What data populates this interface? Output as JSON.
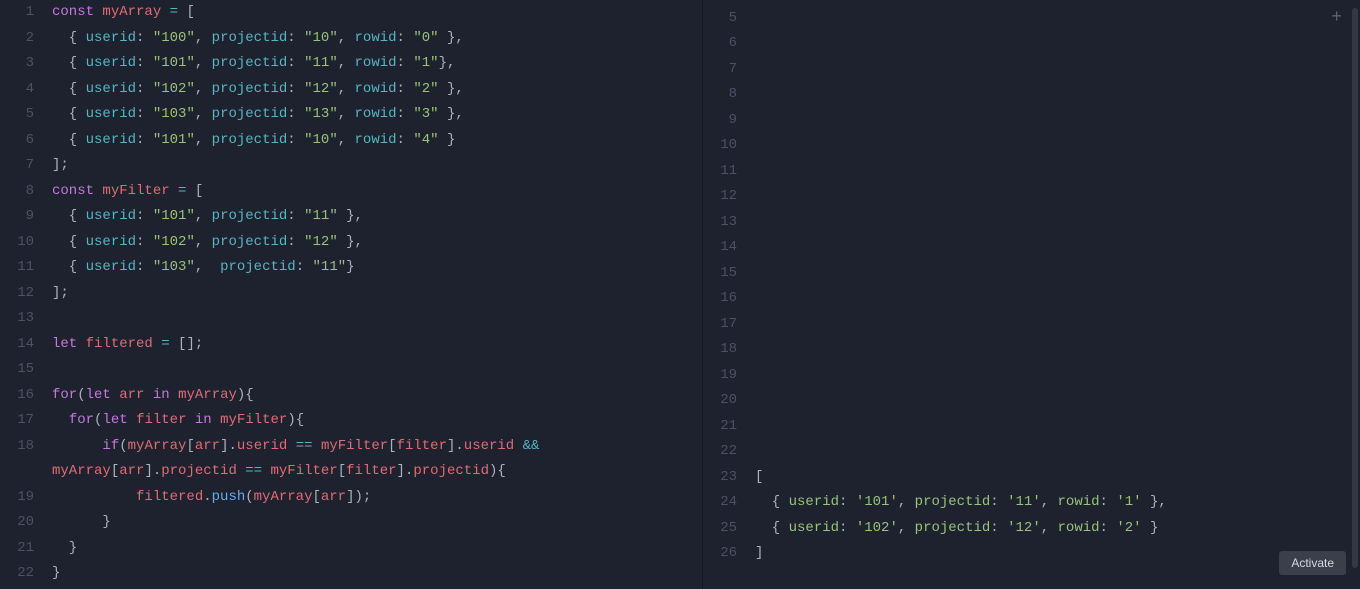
{
  "leftPane": {
    "startLine": 1,
    "lines": [
      [
        [
          "kw",
          "const"
        ],
        [
          "punc",
          " "
        ],
        [
          "var",
          "myArray"
        ],
        [
          "punc",
          " "
        ],
        [
          "op",
          "="
        ],
        [
          "punc",
          " ["
        ]
      ],
      [
        [
          "punc",
          "  { "
        ],
        [
          "prop",
          "userid"
        ],
        [
          "punc",
          ": "
        ],
        [
          "str",
          "\"100\""
        ],
        [
          "punc",
          ", "
        ],
        [
          "prop",
          "projectid"
        ],
        [
          "punc",
          ": "
        ],
        [
          "str",
          "\"10\""
        ],
        [
          "punc",
          ", "
        ],
        [
          "prop",
          "rowid"
        ],
        [
          "punc",
          ": "
        ],
        [
          "str",
          "\"0\""
        ],
        [
          "punc",
          " },"
        ]
      ],
      [
        [
          "punc",
          "  { "
        ],
        [
          "prop",
          "userid"
        ],
        [
          "punc",
          ": "
        ],
        [
          "str",
          "\"101\""
        ],
        [
          "punc",
          ", "
        ],
        [
          "prop",
          "projectid"
        ],
        [
          "punc",
          ": "
        ],
        [
          "str",
          "\"11\""
        ],
        [
          "punc",
          ", "
        ],
        [
          "prop",
          "rowid"
        ],
        [
          "punc",
          ": "
        ],
        [
          "str",
          "\"1\""
        ],
        [
          "punc",
          "},"
        ]
      ],
      [
        [
          "punc",
          "  { "
        ],
        [
          "prop",
          "userid"
        ],
        [
          "punc",
          ": "
        ],
        [
          "str",
          "\"102\""
        ],
        [
          "punc",
          ", "
        ],
        [
          "prop",
          "projectid"
        ],
        [
          "punc",
          ": "
        ],
        [
          "str",
          "\"12\""
        ],
        [
          "punc",
          ", "
        ],
        [
          "prop",
          "rowid"
        ],
        [
          "punc",
          ": "
        ],
        [
          "str",
          "\"2\""
        ],
        [
          "punc",
          " },"
        ]
      ],
      [
        [
          "punc",
          "  { "
        ],
        [
          "prop",
          "userid"
        ],
        [
          "punc",
          ": "
        ],
        [
          "str",
          "\"103\""
        ],
        [
          "punc",
          ", "
        ],
        [
          "prop",
          "projectid"
        ],
        [
          "punc",
          ": "
        ],
        [
          "str",
          "\"13\""
        ],
        [
          "punc",
          ", "
        ],
        [
          "prop",
          "rowid"
        ],
        [
          "punc",
          ": "
        ],
        [
          "str",
          "\"3\""
        ],
        [
          "punc",
          " },"
        ]
      ],
      [
        [
          "punc",
          "  { "
        ],
        [
          "prop",
          "userid"
        ],
        [
          "punc",
          ": "
        ],
        [
          "str",
          "\"101\""
        ],
        [
          "punc",
          ", "
        ],
        [
          "prop",
          "projectid"
        ],
        [
          "punc",
          ": "
        ],
        [
          "str",
          "\"10\""
        ],
        [
          "punc",
          ", "
        ],
        [
          "prop",
          "rowid"
        ],
        [
          "punc",
          ": "
        ],
        [
          "str",
          "\"4\""
        ],
        [
          "punc",
          " }"
        ]
      ],
      [
        [
          "punc",
          "];"
        ]
      ],
      [
        [
          "kw",
          "const"
        ],
        [
          "punc",
          " "
        ],
        [
          "var",
          "myFilter"
        ],
        [
          "punc",
          " "
        ],
        [
          "op",
          "="
        ],
        [
          "punc",
          " ["
        ]
      ],
      [
        [
          "punc",
          "  { "
        ],
        [
          "prop",
          "userid"
        ],
        [
          "punc",
          ": "
        ],
        [
          "str",
          "\"101\""
        ],
        [
          "punc",
          ", "
        ],
        [
          "prop",
          "projectid"
        ],
        [
          "punc",
          ": "
        ],
        [
          "str",
          "\"11\""
        ],
        [
          "punc",
          " },"
        ]
      ],
      [
        [
          "punc",
          "  { "
        ],
        [
          "prop",
          "userid"
        ],
        [
          "punc",
          ": "
        ],
        [
          "str",
          "\"102\""
        ],
        [
          "punc",
          ", "
        ],
        [
          "prop",
          "projectid"
        ],
        [
          "punc",
          ": "
        ],
        [
          "str",
          "\"12\""
        ],
        [
          "punc",
          " },"
        ]
      ],
      [
        [
          "punc",
          "  { "
        ],
        [
          "prop",
          "userid"
        ],
        [
          "punc",
          ": "
        ],
        [
          "str",
          "\"103\""
        ],
        [
          "punc",
          ",  "
        ],
        [
          "prop",
          "projectid"
        ],
        [
          "punc",
          ": "
        ],
        [
          "str",
          "\"11\""
        ],
        [
          "punc",
          "}"
        ]
      ],
      [
        [
          "punc",
          "];"
        ]
      ],
      [],
      [
        [
          "kw",
          "let"
        ],
        [
          "punc",
          " "
        ],
        [
          "var",
          "filtered"
        ],
        [
          "punc",
          " "
        ],
        [
          "op",
          "="
        ],
        [
          "punc",
          " [];"
        ]
      ],
      [],
      [
        [
          "kw",
          "for"
        ],
        [
          "punc",
          "("
        ],
        [
          "kw",
          "let"
        ],
        [
          "punc",
          " "
        ],
        [
          "var",
          "arr"
        ],
        [
          "punc",
          " "
        ],
        [
          "kw",
          "in"
        ],
        [
          "punc",
          " "
        ],
        [
          "var",
          "myArray"
        ],
        [
          "punc",
          "){"
        ]
      ],
      [
        [
          "punc",
          "  "
        ],
        [
          "kw",
          "for"
        ],
        [
          "punc",
          "("
        ],
        [
          "kw",
          "let"
        ],
        [
          "punc",
          " "
        ],
        [
          "var",
          "filter"
        ],
        [
          "punc",
          " "
        ],
        [
          "kw",
          "in"
        ],
        [
          "punc",
          " "
        ],
        [
          "var",
          "myFilter"
        ],
        [
          "punc",
          "){"
        ]
      ],
      [
        [
          "punc",
          "      "
        ],
        [
          "kw",
          "if"
        ],
        [
          "punc",
          "("
        ],
        [
          "var",
          "myArray"
        ],
        [
          "punc",
          "["
        ],
        [
          "var",
          "arr"
        ],
        [
          "punc",
          "]."
        ],
        [
          "var",
          "userid"
        ],
        [
          "punc",
          " "
        ],
        [
          "op",
          "=="
        ],
        [
          "punc",
          " "
        ],
        [
          "var",
          "myFilter"
        ],
        [
          "punc",
          "["
        ],
        [
          "var",
          "filter"
        ],
        [
          "punc",
          "]."
        ],
        [
          "var",
          "userid"
        ],
        [
          "punc",
          " "
        ],
        [
          "op",
          "&&"
        ],
        [
          "punc",
          " "
        ],
        [
          "var",
          "myArray"
        ],
        [
          "punc",
          "["
        ],
        [
          "var",
          "arr"
        ],
        [
          "punc",
          "]."
        ],
        [
          "var",
          "projectid"
        ],
        [
          "punc",
          " "
        ],
        [
          "op",
          "=="
        ],
        [
          "punc",
          " "
        ],
        [
          "var",
          "myFilter"
        ],
        [
          "punc",
          "["
        ],
        [
          "var",
          "filter"
        ],
        [
          "punc",
          "]."
        ],
        [
          "var",
          "projectid"
        ],
        [
          "punc",
          "){"
        ]
      ],
      [
        [
          "punc",
          "          "
        ],
        [
          "var",
          "filtered"
        ],
        [
          "punc",
          "."
        ],
        [
          "fn",
          "push"
        ],
        [
          "punc",
          "("
        ],
        [
          "var",
          "myArray"
        ],
        [
          "punc",
          "["
        ],
        [
          "var",
          "arr"
        ],
        [
          "punc",
          "]);"
        ]
      ],
      [
        [
          "punc",
          "      }"
        ]
      ],
      [
        [
          "punc",
          "  }"
        ]
      ],
      [
        [
          "punc",
          "}"
        ]
      ]
    ]
  },
  "rightPane": {
    "startLine": 4,
    "lines": [
      [],
      [],
      [],
      [],
      [],
      [],
      [],
      [],
      [],
      [],
      [],
      [],
      [],
      [],
      [],
      [],
      [],
      [],
      [],
      [
        [
          "out",
          "["
        ]
      ],
      [
        [
          "out",
          "  { "
        ],
        [
          "out-prop",
          "userid"
        ],
        [
          "out",
          ": "
        ],
        [
          "out-str",
          "'101'"
        ],
        [
          "out",
          ", "
        ],
        [
          "out-prop",
          "projectid"
        ],
        [
          "out",
          ": "
        ],
        [
          "out-str",
          "'11'"
        ],
        [
          "out",
          ", "
        ],
        [
          "out-prop",
          "rowid"
        ],
        [
          "out",
          ": "
        ],
        [
          "out-str",
          "'1'"
        ],
        [
          "out",
          " },"
        ]
      ],
      [
        [
          "out",
          "  { "
        ],
        [
          "out-prop",
          "userid"
        ],
        [
          "out",
          ": "
        ],
        [
          "out-str",
          "'102'"
        ],
        [
          "out",
          ", "
        ],
        [
          "out-prop",
          "projectid"
        ],
        [
          "out",
          ": "
        ],
        [
          "out-str",
          "'12'"
        ],
        [
          "out",
          ", "
        ],
        [
          "out-prop",
          "rowid"
        ],
        [
          "out",
          ": "
        ],
        [
          "out-str",
          "'2'"
        ],
        [
          "out",
          " }"
        ]
      ],
      [
        [
          "out",
          "]"
        ]
      ]
    ]
  },
  "buttons": {
    "activate": "Activate"
  },
  "icons": {
    "plus": "+"
  }
}
